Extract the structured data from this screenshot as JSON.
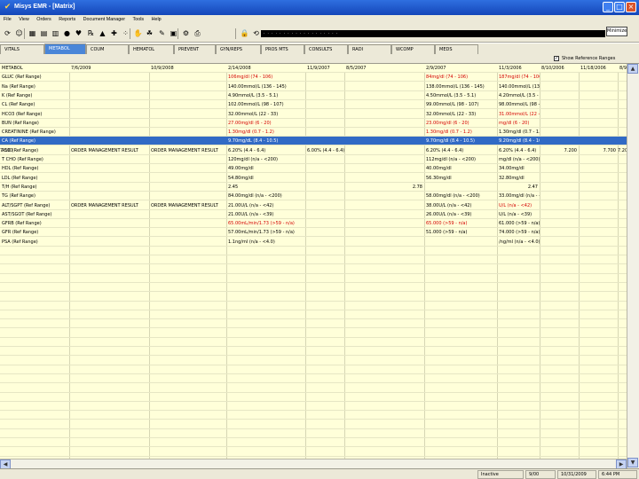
{
  "window": {
    "title": "Misys EMR - [Matrix]",
    "min": "_",
    "max": "□",
    "close": "×"
  },
  "menu": [
    "File",
    "View",
    "Orders",
    "Reports",
    "Document Manager",
    "Tools",
    "Help"
  ],
  "toolbar": {
    "icons": [
      "refresh-icon",
      "patient-icon",
      "calculator-icon",
      "grid-icon",
      "calendar-icon",
      "apple-icon",
      "heart-icon",
      "pill-icon",
      "chart-icon",
      "syringe-icon",
      "dots-icon",
      "hand-icon",
      "lungs-icon",
      "pencil-icon",
      "sticky-icon",
      "settings-icon",
      "print-icon",
      "lock-icon",
      "refresh2-icon"
    ],
    "glyphs": [
      "⟳",
      "☺",
      "▦",
      "▤",
      "▥",
      "●",
      "♥",
      "℞",
      "▲",
      "✚",
      "⁘",
      "✋",
      "☘",
      "✎",
      "▣",
      "⚙",
      "⎙",
      "🔒",
      "⟲"
    ],
    "combo": "· · · · · · · · · ·  · · · · · · · · ·",
    "minimize_label": "Minimize"
  },
  "tabs": [
    "VITALS",
    "METABOL",
    "COUM",
    "HEMATOL",
    "PREVENT",
    "GYN/REPS",
    "PROS MTS",
    "CONSULTS",
    "RADI",
    "WCOMP",
    "MEDS"
  ],
  "active_tab": 1,
  "show_ref_label": "Show Reference Ranges",
  "show_ref_checked": "✓",
  "columns": [
    "METABOL",
    "7/6/2009",
    "10/9/2008",
    "2/14/2008",
    "11/9/2007",
    "8/5/2007",
    "2/9/2007",
    "11/3/2006",
    "8/10/2006",
    "11/18/2006",
    "8/9"
  ],
  "rows": [
    {
      "label": "GLUC (Ref Range)",
      "v": [
        "",
        "",
        "106mg/dl (74 - 106)",
        "",
        "",
        "84mg/dl (74 - 106)",
        "187mg/dl (74 - 106)",
        "",
        "",
        "",
        ""
      ],
      "red": [
        2,
        5,
        6
      ]
    },
    {
      "label": "Na (Ref Range)",
      "v": [
        "",
        "",
        "140.00mmol/L (136 - 145)",
        "",
        "",
        "138.00mmol/L (136 - 145)",
        "140.00mmol/L (136 - 145)",
        "",
        "",
        "",
        ""
      ]
    },
    {
      "label": "K (Ref Range)",
      "v": [
        "",
        "",
        "4.90mmol/L (3.5 - 5.1)",
        "",
        "",
        "4.50mmol/L (3.5 - 5.1)",
        "4.20mmol/L (3.5 - 5.1)",
        "",
        "",
        "",
        ""
      ]
    },
    {
      "label": "CL (Ref Range)",
      "v": [
        "",
        "",
        "102.00mmol/L (98 - 107)",
        "",
        "",
        "99.00mmol/L (98 - 107)",
        "98.00mmol/L (98 - 107)",
        "",
        "",
        "",
        ""
      ]
    },
    {
      "label": "HCO3 (Ref Range)",
      "v": [
        "",
        "",
        "32.00mmol/L (22 - 33)",
        "",
        "",
        "32.00mmol/L (22 - 33)",
        "31.00mmol/L (22 - 29)",
        "",
        "",
        "",
        ""
      ],
      "red": [
        6
      ]
    },
    {
      "label": "BUN (Ref Range)",
      "v": [
        "",
        "",
        "27.00mg/dl (6 - 20)",
        "",
        "",
        "23.00mg/dl (6 - 20)",
        "mg/dl (6 - 20)",
        "",
        "",
        "",
        ""
      ],
      "red": [
        2,
        5,
        6
      ]
    },
    {
      "label": "CREATININE (Ref Range)",
      "v": [
        "",
        "",
        "1.30mg/dl (0.7 - 1.2)",
        "",
        "",
        "1.30mg/dl (0.7 - 1.2)",
        "1.30mg/dl (0.7 - 1.2)",
        "",
        "",
        "",
        ""
      ],
      "red": [
        2,
        5
      ]
    },
    {
      "label": "CA (Ref Range)",
      "v": [
        "",
        "",
        "9.70mg/dL (8.4 - 10.5)",
        "",
        "",
        "9.70mg/dl (8.4 - 10.5)",
        "9.20mg/dl (8.4 - 10.5)",
        "",
        "",
        "",
        ""
      ],
      "sel": true
    },
    {
      "label": "A1C (Ref Range)",
      "v": [
        "ORDER MANAGEMENT RESULT",
        "ORDER MANAGEMENT RESULT",
        "6.20% (4.4 - 6.4)",
        "6.00% (4.4 - 6.4)",
        "",
        "6.20% (4.4 - 6.4)",
        "6.20% (4.4 - 6.4)",
        "7.200",
        "7.700",
        "7.200",
        "7.500"
      ]
    },
    {
      "label": "T CHO (Ref Range)",
      "v": [
        "",
        "",
        "120mg/dl (n/a - <200)",
        "",
        "",
        "112mg/dl (n/a - <200)",
        "mg/dl (n/a - <200)",
        "",
        "",
        "",
        ""
      ]
    },
    {
      "label": "HDL (Ref Range)",
      "v": [
        "",
        "",
        "49.00mg/dl",
        "",
        "",
        "40.00mg/dl",
        "34.00mg/dl",
        "",
        "",
        "",
        ""
      ]
    },
    {
      "label": "LDL (Ref Range)",
      "v": [
        "",
        "",
        "54.80mg/dl",
        "",
        "",
        "56.30mg/dl",
        "32.80mg/dl",
        "",
        "",
        "",
        ""
      ]
    },
    {
      "label": "T/H (Ref Range)",
      "v": [
        "",
        "",
        "2.45",
        "",
        "2.78",
        "",
        "2.47",
        "",
        "",
        "",
        ""
      ],
      "rightcols": [
        3,
        4,
        6
      ]
    },
    {
      "label": "TG (Ref Range)",
      "v": [
        "",
        "",
        "84.00mg/dl (n/a - <200)",
        "",
        "",
        "58.00mg/dl (n/a - <200)",
        "33.00mg/dl (n/a - <200)",
        "",
        "",
        "",
        ""
      ]
    },
    {
      "label": "ALT/SGPT (Ref Range)",
      "v": [
        "ORDER MANAGEMENT RESULT",
        "ORDER MANAGEMENT RESULT",
        "21.00U/L (n/a - <42)",
        "",
        "",
        "38.00U/L (n/a - <42)",
        "U/L (n/a - <42)",
        "",
        "",
        "",
        ""
      ],
      "red": [
        6
      ]
    },
    {
      "label": "AST/SGOT (Ref Range)",
      "v": [
        "",
        "",
        "21.00U/L (n/a - <39)",
        "",
        "",
        "26.00U/L (n/a - <39)",
        "U/L (n/a - <39)",
        "",
        "",
        "",
        ""
      ]
    },
    {
      "label": "GFRB (Ref Range)",
      "v": [
        "",
        "",
        "65.00mL/min/1.73 (>59 - n/a)",
        "",
        "",
        "65.000 (>59 - n/a)",
        "61.000 (>59 - n/a)",
        "",
        "",
        "",
        ""
      ],
      "red": [
        2,
        5
      ]
    },
    {
      "label": "GFR (Ref Range)",
      "v": [
        "",
        "",
        "57.00mL/min/1.73 (>59 - n/a)",
        "",
        "",
        "51.000 (>59 - n/a)",
        "74.000 (>59 - n/a)",
        "",
        "",
        "",
        ""
      ]
    },
    {
      "label": "PSA (Ref Range)",
      "v": [
        "",
        "",
        "1.1ng/ml (n/a - <4.0)",
        "",
        "",
        "",
        "/ng/ml (n/a - <4.0)",
        "",
        "",
        "",
        ""
      ]
    }
  ],
  "status": [
    "Inactive",
    "9/00",
    "10/31/2009",
    "6:44 PM"
  ],
  "scroll": {
    "left": "◀",
    "right": "▶",
    "up": "▲",
    "down": "▼"
  }
}
